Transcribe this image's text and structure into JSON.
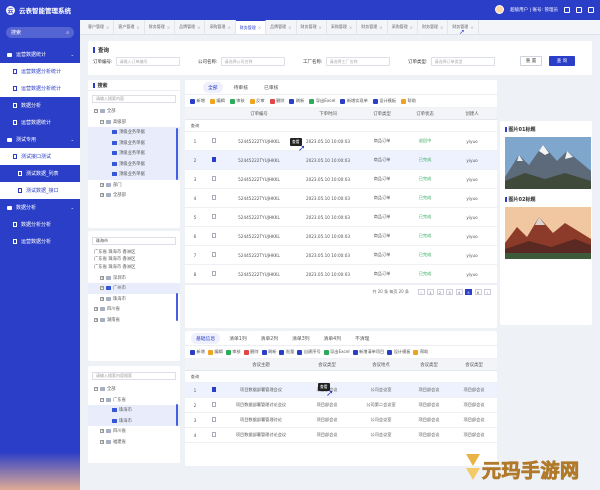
{
  "app": {
    "title": "云表智能管理系统",
    "logo_char": "云"
  },
  "sidebar": {
    "search_placeholder": "搜索",
    "items": [
      {
        "label": "运营数据统计",
        "level": 0
      },
      {
        "label": "运营数据分析统计",
        "level": 1
      },
      {
        "label": "运营数据分析统计",
        "level": 1
      },
      {
        "label": "数据分析",
        "level": 1
      },
      {
        "label": "运营数据统计",
        "level": 1
      },
      {
        "label": "测试专用",
        "level": 0
      },
      {
        "label": "测试接口测试",
        "level": 1
      },
      {
        "label": "测试数据_列表",
        "level": 2
      },
      {
        "label": "测试数据_接口",
        "level": 2
      },
      {
        "label": "数据分析",
        "level": 0
      },
      {
        "label": "数据分析分析",
        "level": 1
      },
      {
        "label": "运营数据分析",
        "level": 1
      }
    ]
  },
  "topbar": {
    "user": "超级用户 | 账号: 管理员"
  },
  "tabs": [
    "客户管理",
    "客户管理",
    "财务管理",
    "品牌管理",
    "采购管理",
    "财务管理",
    "品牌管理",
    "财务管理",
    "采购管理",
    "财务管理",
    "采购管理",
    "财务管理",
    "财务管理"
  ],
  "query": {
    "title": "查询",
    "fields": [
      {
        "label": "订单编号:",
        "placeholder": "请输入订单编号"
      },
      {
        "label": "公司名称:",
        "placeholder": "请选择公司名称"
      },
      {
        "label": "工厂名称:",
        "placeholder": "请选择工厂名称"
      },
      {
        "label": "订单类型:",
        "placeholder": "请选择订单类型"
      }
    ],
    "reset": "重 置",
    "search": "查 询"
  },
  "tree1": {
    "title": "搜索",
    "search_placeholder": "请输入搜索内容",
    "nodes": [
      {
        "label": "全部",
        "depth": 0,
        "exp": "−"
      },
      {
        "label": "高级部",
        "depth": 1,
        "exp": "−"
      },
      {
        "label": "顶级业务单据",
        "depth": 2
      },
      {
        "label": "顶级业务单据",
        "depth": 2
      },
      {
        "label": "顶级业务单据",
        "depth": 2
      },
      {
        "label": "顶级业务单据",
        "depth": 2
      },
      {
        "label": "顶级业务单据",
        "depth": 2
      },
      {
        "label": "部门",
        "depth": 1,
        "exp": "+"
      },
      {
        "label": "全部部",
        "depth": 1,
        "exp": "+"
      }
    ]
  },
  "tree2": {
    "search_value": "珠海市",
    "crumbs": [
      "广东省 珠海市 香洲区",
      "广东省 珠海市 香洲区",
      "广东省 珠海市 香洲区"
    ],
    "nodes": [
      {
        "label": "深圳市",
        "depth": 1,
        "exp": "+"
      },
      {
        "label": "广州市",
        "depth": 1,
        "exp": "−"
      },
      {
        "label": "珠海市",
        "depth": 1,
        "exp": "+"
      },
      {
        "label": "四川省",
        "depth": 0,
        "exp": "+"
      },
      {
        "label": "湖南省",
        "depth": 0,
        "exp": "+"
      }
    ]
  },
  "tree3": {
    "search_placeholder": "请输入搜索内容搜索",
    "nodes": [
      {
        "label": "全部",
        "depth": 0,
        "exp": "−"
      },
      {
        "label": "广东省",
        "depth": 1,
        "exp": "−"
      },
      {
        "label": "珠海市",
        "depth": 2
      },
      {
        "label": "珠海市",
        "depth": 2
      },
      {
        "label": "四川省",
        "depth": 1,
        "exp": "+"
      },
      {
        "label": "福建省",
        "depth": 1,
        "exp": "+"
      }
    ]
  },
  "grid1": {
    "subtabs": [
      "全部",
      "待审核",
      "已审核"
    ],
    "toolbar": [
      {
        "label": "新增",
        "color": "#2b3ec8"
      },
      {
        "label": "编辑",
        "color": "#f0a31e"
      },
      {
        "label": "审核",
        "color": "#2cab5a"
      },
      {
        "label": "反审",
        "color": "#f0a31e"
      },
      {
        "label": "删除",
        "color": "#e04848"
      },
      {
        "label": "刷新",
        "color": "#2b3ec8"
      },
      {
        "label": "导出Excel",
        "color": "#2cab5a"
      },
      {
        "label": "新增实现单",
        "color": "#2b3ec8"
      },
      {
        "label": "设计模板",
        "color": "#2b3ec8"
      },
      {
        "label": "帮助",
        "color": "#f0a31e"
      }
    ],
    "columns": [
      "",
      "",
      "订单编号",
      "下单时间",
      "订单类型",
      "订单状态",
      "创建人"
    ],
    "header_row_label": "查询",
    "rows": [
      {
        "num": "1",
        "code": "52445222TYUJHKKL",
        "time": "2023.05.10 10:00:03",
        "type": "商品订单",
        "status": "退回中",
        "status_color": "green",
        "user": "yiyuo",
        "checked": false
      },
      {
        "num": "2",
        "code": "52445222TYUJHKKL",
        "time": "2023.05.10 10:00:03",
        "type": "商品订单",
        "status": "已完成",
        "status_color": "green",
        "user": "yiyuo",
        "checked": true
      },
      {
        "num": "3",
        "code": "52445222TYUJHKKL",
        "time": "2023.05.10 10:00:03",
        "type": "商品订单",
        "status": "已完成",
        "status_color": "green",
        "user": "yiyuo",
        "checked": false
      },
      {
        "num": "4",
        "code": "52445222TYUJHKKL",
        "time": "2023.05.10 10:00:03",
        "type": "商品订单",
        "status": "已完成",
        "status_color": "green",
        "user": "yiyuo",
        "checked": false
      },
      {
        "num": "5",
        "code": "52445222TYUJHKKL",
        "time": "2023.05.10 10:00:03",
        "type": "商品订单",
        "status": "已完成",
        "status_color": "green",
        "user": "yiyuo",
        "checked": false
      },
      {
        "num": "6",
        "code": "52445222TYUJHKKL",
        "time": "2023.05.10 10:00:03",
        "type": "商品订单",
        "status": "已完成",
        "status_color": "green",
        "user": "yiyuo",
        "checked": false
      },
      {
        "num": "7",
        "code": "52445222TYUJHKKL",
        "time": "2023.05.10 10:00:03",
        "type": "商品订单",
        "status": "已完成",
        "status_color": "green",
        "user": "yiyuo",
        "checked": false
      },
      {
        "num": "8",
        "code": "52445222TYUJHKKL",
        "time": "2023.05.10 10:00:03",
        "type": "商品订单",
        "status": "已完成",
        "status_color": "green",
        "user": "yiyuo",
        "checked": false
      }
    ],
    "pager": {
      "summary": "共 20 条  每页 20 条",
      "pages": [
        "1",
        "2",
        "3",
        "4",
        "5",
        "6"
      ],
      "current": "5"
    },
    "tooltip": "查看"
  },
  "grid2": {
    "subtabs": [
      "基础信息",
      "清单1列",
      "清单2列",
      "清单3列",
      "清单4列",
      "不清理"
    ],
    "toolbar": [
      {
        "label": "新增",
        "color": "#2b3ec8"
      },
      {
        "label": "编辑",
        "color": "#f0a31e"
      },
      {
        "label": "审核",
        "color": "#2cab5a"
      },
      {
        "label": "删除",
        "color": "#e04848"
      },
      {
        "label": "刷新",
        "color": "#2b3ec8"
      },
      {
        "label": "批量",
        "color": "#2b3ec8"
      },
      {
        "label": "自建序号",
        "color": "#2b3ec8"
      },
      {
        "label": "导出Excel",
        "color": "#2cab5a"
      },
      {
        "label": "新增清单项目",
        "color": "#2b3ec8"
      },
      {
        "label": "设计模板",
        "color": "#2b3ec8"
      },
      {
        "label": "帮助",
        "color": "#f0a31e"
      }
    ],
    "columns": [
      "",
      "",
      "会议主题",
      "会议类型",
      "会议地点",
      "会议类型",
      "会议类型"
    ],
    "header_row_label": "查询",
    "rows": [
      {
        "num": "1",
        "topic": "项目数据部署管理会议",
        "type": "项目部会议",
        "place": "公司会议室",
        "t2": "项目部会议",
        "t3": "项目部会议",
        "checked": true
      },
      {
        "num": "2",
        "topic": "项目数据部署管理讨论会议",
        "type": "项目部会议",
        "place": "公司第二会议室",
        "t2": "项目部会议",
        "t3": "项目部会议",
        "checked": false
      },
      {
        "num": "3",
        "topic": "项目数据部署管理讨论",
        "type": "项目部会议",
        "place": "公司会议室",
        "t2": "项目部会议",
        "t3": "项目部会议",
        "checked": false
      },
      {
        "num": "4",
        "topic": "项目数据部署管理讨论会议",
        "type": "项目部会议",
        "place": "公司会议室",
        "t2": "项目部会议",
        "t3": "项目部会议",
        "checked": false
      }
    ],
    "tooltip": "查看"
  },
  "images": {
    "label1": "图片01标题",
    "label2": "图片02标题"
  },
  "watermark": "元玛手游网"
}
